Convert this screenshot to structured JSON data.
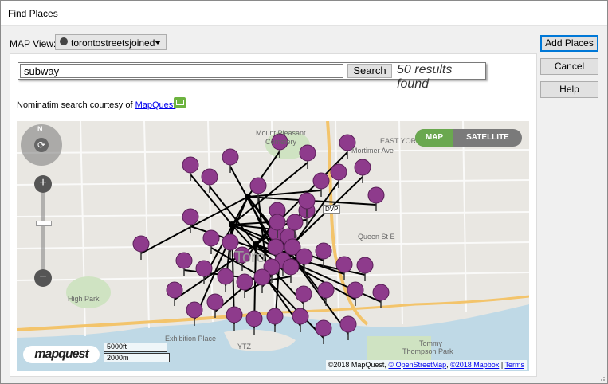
{
  "window": {
    "title": "Find Places"
  },
  "map_view": {
    "label": "MAP View:",
    "selected": "torontostreetsjoined"
  },
  "buttons": {
    "add_places": "Add Places",
    "cancel": "Cancel",
    "help": "Help"
  },
  "search": {
    "value": "subway",
    "button": "Search",
    "results": "50 results found"
  },
  "attribution": {
    "prefix": "Nominatim search courtesy of ",
    "link": "MapQuest"
  },
  "map": {
    "toggle_map": "MAP",
    "toggle_satellite": "SATELLITE",
    "compass_n": "N",
    "zoom_in": "+",
    "zoom_out": "−",
    "labels": {
      "mount_pleasant": "Mount Pleasant",
      "cemetery": "Cemetery",
      "east_york": "EAST YORK",
      "mortimer": "Mortimer Ave",
      "queen": "Queen St E",
      "high_park": "High Park",
      "exhibition": "Exhibition Place",
      "ytz": "YTZ",
      "tommy": "Tommy",
      "thompson": "Thompson Park",
      "toronto": "Toro"
    },
    "dvp": "DVP",
    "logo": "mapquest",
    "scale_ft": "5000ft",
    "scale_m": "2000m",
    "copyright": "©2018 MapQuest,",
    "osm": "© OpenStreetMap",
    "mapbox": "©2018 Mapbox",
    "terms": "Terms",
    "marker_color": "#8e3b8c",
    "water_color": "#bfd9e6"
  }
}
